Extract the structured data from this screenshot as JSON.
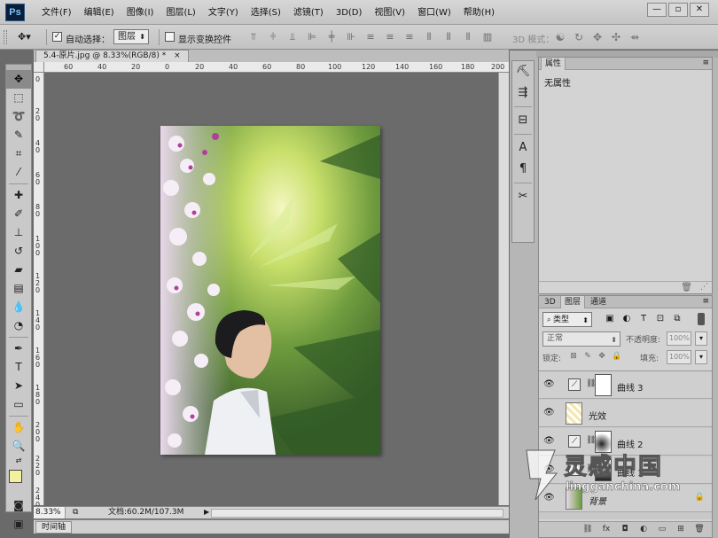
{
  "app": {
    "logo": "Ps"
  },
  "menu": [
    "文件(F)",
    "编辑(E)",
    "图像(I)",
    "图层(L)",
    "文字(Y)",
    "选择(S)",
    "滤镜(T)",
    "3D(D)",
    "视图(V)",
    "窗口(W)",
    "帮助(H)"
  ],
  "window_buttons": {
    "minimize": "—",
    "restore": "▫",
    "close": "✕"
  },
  "options": {
    "auto_select_label": "自动选择：",
    "auto_select_checked": "✓",
    "auto_select_target": "图层",
    "show_transform_label": "显示变换控件",
    "mode3d_label": "3D 模式："
  },
  "document": {
    "tab_title": "5.4-原片.jpg @ 8.33%(RGB/8) *",
    "tab_close": "×",
    "zoom": "8.33%",
    "doc_info": "文档:60.2M/107.3M",
    "ruler_h": [
      "60",
      "40",
      "20",
      "0",
      "20",
      "40",
      "60",
      "80",
      "100",
      "120",
      "140",
      "160",
      "180",
      "200"
    ],
    "ruler_v": [
      "0",
      "2 0",
      "4 0",
      "6 0",
      "8 0",
      "1 0 0",
      "1 2 0",
      "1 4 0",
      "1 6 0",
      "1 8 0",
      "2 0 0",
      "2 2 0",
      "2 4 0"
    ]
  },
  "timeline": {
    "tab": "时间轴"
  },
  "properties": {
    "tab": "属性",
    "content": "无属性"
  },
  "layers_panel": {
    "tabs": [
      "3D",
      "图层",
      "通道"
    ],
    "kind": "类型",
    "blend_mode": "正常",
    "opacity_label": "不透明度:",
    "opacity_value": "100%",
    "lock_label": "锁定:",
    "fill_label": "填充:",
    "fill_value": "100%",
    "layers": [
      {
        "name": "曲线 3",
        "type": "adjustment"
      },
      {
        "name": "光效",
        "type": "pixel"
      },
      {
        "name": "曲线 2",
        "type": "adjustment"
      },
      {
        "name": "曲线 1",
        "type": "adjustment"
      },
      {
        "name": "背景",
        "type": "background"
      }
    ]
  },
  "watermark": {
    "brand": "灵感中国",
    "url": "lingganchina.com"
  },
  "colors": {
    "foreground": "#f5f0a0",
    "background": "#ffffff",
    "canvas_bg": "#6b6b6b"
  }
}
